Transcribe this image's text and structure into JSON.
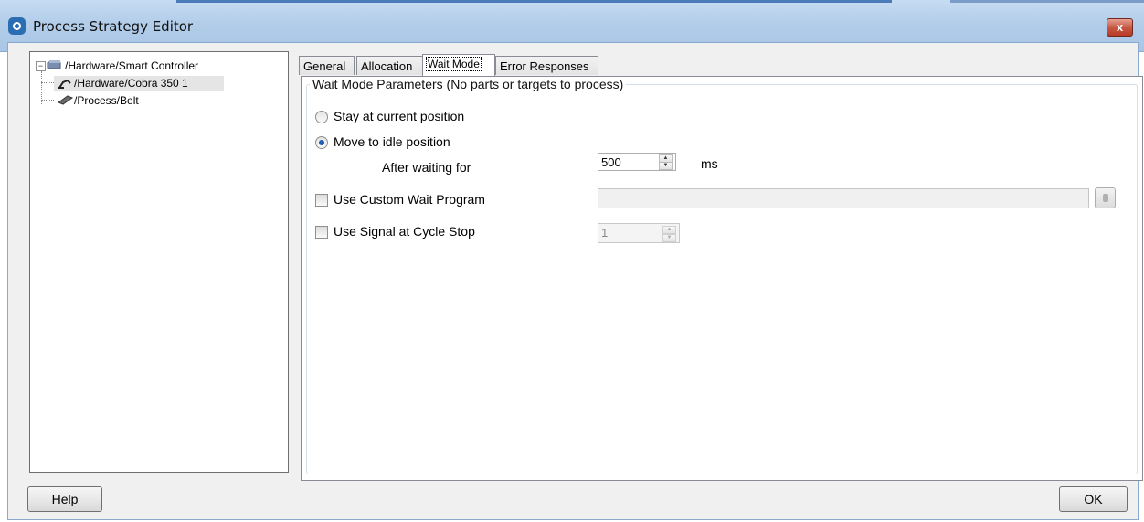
{
  "window": {
    "title": "Process Strategy Editor",
    "close_glyph": "x"
  },
  "tree": {
    "items": [
      {
        "label": "/Hardware/Smart Controller",
        "icon": "controller-icon",
        "expander": "−"
      },
      {
        "label": "/Hardware/Cobra 350 1",
        "icon": "robot-icon"
      },
      {
        "label": "/Process/Belt",
        "icon": "belt-icon"
      }
    ]
  },
  "tabs": [
    {
      "label": "General"
    },
    {
      "label": "Allocation"
    },
    {
      "label": "Wait Mode"
    },
    {
      "label": "Error Responses"
    }
  ],
  "wait_mode": {
    "group_title": "Wait Mode Parameters (No parts or targets to process)",
    "stay_label": "Stay at current position",
    "move_label": "Move to idle position",
    "after_waiting_label": "After waiting for",
    "wait_value": "500",
    "unit": "ms",
    "custom_program_label": "Use Custom Wait Program",
    "signal_label": "Use Signal at Cycle Stop",
    "signal_value": "1",
    "selected_option": "Move to idle position"
  },
  "buttons": {
    "help": "Help",
    "ok": "OK"
  },
  "colors": {
    "title_bar": "#b3cde9",
    "close_button": "#c75845",
    "radio_selected": "#1b5eb2"
  }
}
